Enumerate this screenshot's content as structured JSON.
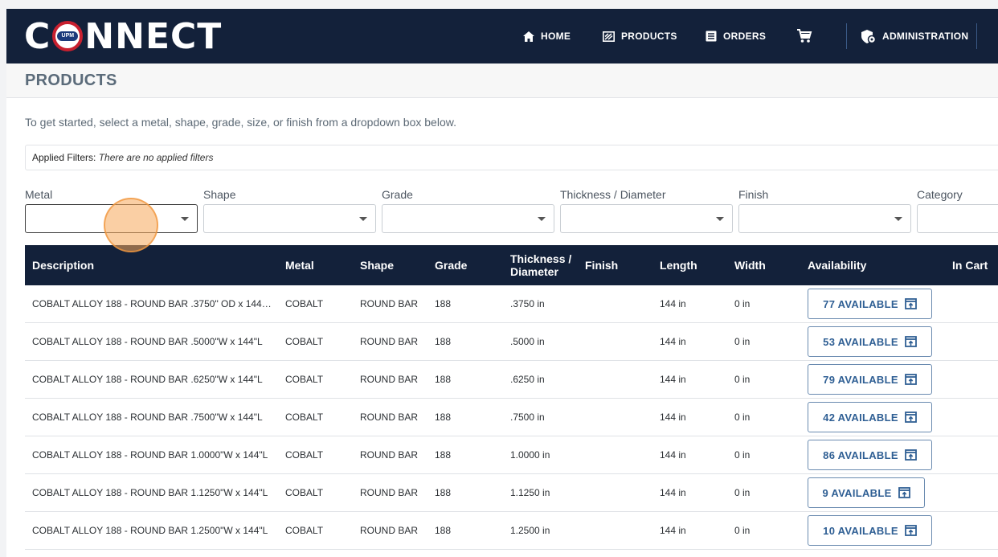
{
  "header": {
    "logo_text_left": "C",
    "logo_badge": "UPM",
    "logo_text_right": "NNECT",
    "nav": [
      {
        "label": "HOME",
        "icon": "home-icon"
      },
      {
        "label": "PRODUCTS",
        "icon": "products-icon"
      },
      {
        "label": "ORDERS",
        "icon": "orders-icon"
      },
      {
        "label": "",
        "icon": "cart-icon"
      },
      {
        "label": "ADMINISTRATION",
        "icon": "admin-shield-icon"
      }
    ]
  },
  "page": {
    "title": "PRODUCTS",
    "intro": "To get started, select a metal, shape, grade, size, or finish from a dropdown box below.",
    "applied_filters_label": "Applied Filters:",
    "applied_filters_value": "There are no applied filters"
  },
  "filters": [
    {
      "label": "Metal",
      "value": ""
    },
    {
      "label": "Shape",
      "value": ""
    },
    {
      "label": "Grade",
      "value": ""
    },
    {
      "label": "Thickness / Diameter",
      "value": ""
    },
    {
      "label": "Finish",
      "value": ""
    },
    {
      "label": "Category",
      "value": ""
    }
  ],
  "table": {
    "columns": [
      "Description",
      "Metal",
      "Shape",
      "Grade",
      "Thickness / Diameter",
      "Finish",
      "Length",
      "Width",
      "Availability",
      "In Cart"
    ],
    "rows": [
      {
        "description": "COBALT ALLOY 188 - ROUND BAR .3750\" OD x 144…",
        "metal": "COBALT",
        "shape": "ROUND BAR",
        "grade": "188",
        "thickness": ".3750 in",
        "finish": "",
        "length": "144 in",
        "width": "0 in",
        "availability": "77 AVAILABLE",
        "in_cart": ""
      },
      {
        "description": "COBALT ALLOY 188 - ROUND BAR .5000\"W x 144\"L",
        "metal": "COBALT",
        "shape": "ROUND BAR",
        "grade": "188",
        "thickness": ".5000 in",
        "finish": "",
        "length": "144 in",
        "width": "0 in",
        "availability": "53 AVAILABLE",
        "in_cart": ""
      },
      {
        "description": "COBALT ALLOY 188 - ROUND BAR .6250\"W x 144\"L",
        "metal": "COBALT",
        "shape": "ROUND BAR",
        "grade": "188",
        "thickness": ".6250 in",
        "finish": "",
        "length": "144 in",
        "width": "0 in",
        "availability": "79 AVAILABLE",
        "in_cart": ""
      },
      {
        "description": "COBALT ALLOY 188 - ROUND BAR .7500\"W x 144\"L",
        "metal": "COBALT",
        "shape": "ROUND BAR",
        "grade": "188",
        "thickness": ".7500 in",
        "finish": "",
        "length": "144 in",
        "width": "0 in",
        "availability": "42 AVAILABLE",
        "in_cart": ""
      },
      {
        "description": "COBALT ALLOY 188 - ROUND BAR 1.0000\"W x 144\"L",
        "metal": "COBALT",
        "shape": "ROUND BAR",
        "grade": "188",
        "thickness": "1.0000 in",
        "finish": "",
        "length": "144 in",
        "width": "0 in",
        "availability": "86 AVAILABLE",
        "in_cart": ""
      },
      {
        "description": "COBALT ALLOY 188 - ROUND BAR 1.1250\"W x 144\"L",
        "metal": "COBALT",
        "shape": "ROUND BAR",
        "grade": "188",
        "thickness": "1.1250 in",
        "finish": "",
        "length": "144 in",
        "width": "0 in",
        "availability": "9 AVAILABLE",
        "in_cart": ""
      },
      {
        "description": "COBALT ALLOY 188 - ROUND BAR 1.2500\"W x 144\"L",
        "metal": "COBALT",
        "shape": "ROUND BAR",
        "grade": "188",
        "thickness": "1.2500 in",
        "finish": "",
        "length": "144 in",
        "width": "0 in",
        "availability": "10 AVAILABLE",
        "in_cart": ""
      }
    ]
  },
  "colors": {
    "header_bg": "#13213a",
    "accent_blue": "#2f5f94",
    "logo_red": "#c8202f"
  }
}
